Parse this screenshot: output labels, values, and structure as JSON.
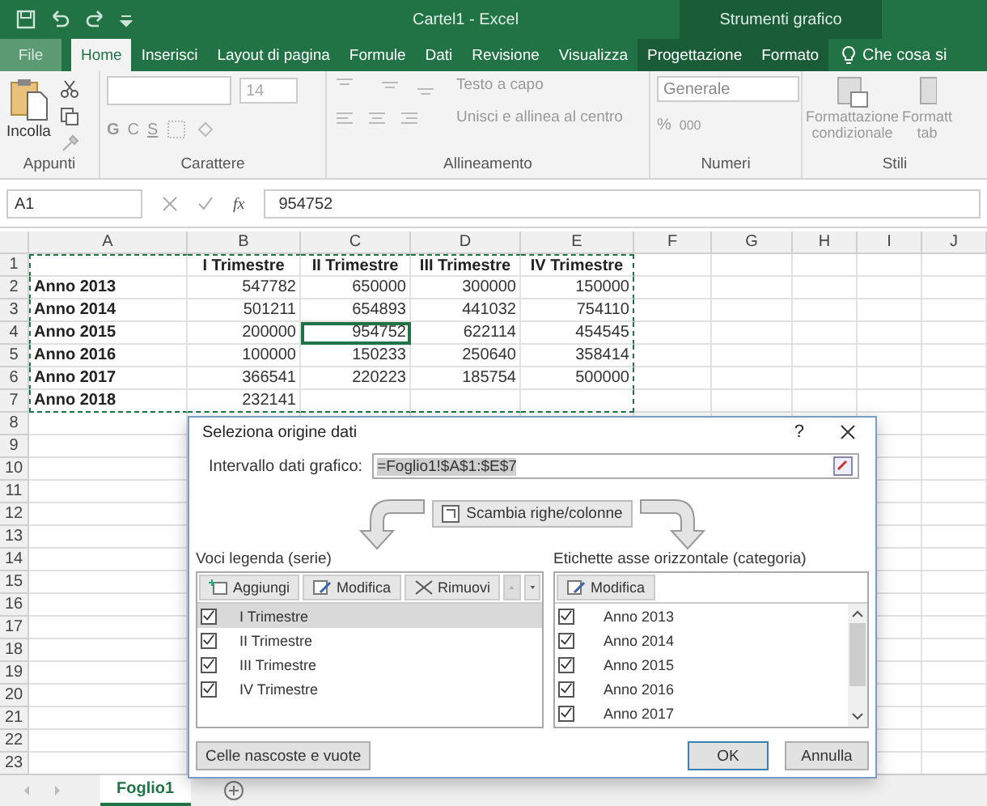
{
  "window": {
    "title": "Cartel1 - Excel",
    "context_title": "Strumenti grafico"
  },
  "tabs": [
    {
      "label": "File",
      "selected": false,
      "kind": "file"
    },
    {
      "label": "Home",
      "selected": true,
      "kind": "normal"
    },
    {
      "label": "Inserisci",
      "selected": false,
      "kind": "normal"
    },
    {
      "label": "Layout di pagina",
      "selected": false,
      "kind": "normal"
    },
    {
      "label": "Formule",
      "selected": false,
      "kind": "normal"
    },
    {
      "label": "Dati",
      "selected": false,
      "kind": "normal"
    },
    {
      "label": "Revisione",
      "selected": false,
      "kind": "normal"
    },
    {
      "label": "Visualizza",
      "selected": false,
      "kind": "normal"
    },
    {
      "label": "Progettazione",
      "selected": false,
      "kind": "contextual"
    },
    {
      "label": "Formato",
      "selected": false,
      "kind": "contextual"
    }
  ],
  "tell_me": "Che cosa si",
  "ribbon": {
    "clipboard": {
      "paste": "Incolla",
      "label": "Appunti"
    },
    "font": {
      "size": "14",
      "bold": "G",
      "italic": "C",
      "underline": "S",
      "label": "Carattere"
    },
    "alignment": {
      "wrap": "Testo a capo",
      "merge": "Unisci e allinea al centro",
      "label": "Allineamento"
    },
    "number": {
      "format": "Generale",
      "percent": "%",
      "thousands": "000",
      "label": "Numeri"
    },
    "styles": {
      "conditional": [
        "Formattazione",
        "condizionale"
      ],
      "table": [
        "Formatt",
        "tab"
      ],
      "label": "Stili"
    }
  },
  "formula_bar": {
    "name_box": "A1",
    "function_label": "fx",
    "value": "954752"
  },
  "sheet": {
    "columns": [
      "A",
      "B",
      "C",
      "D",
      "E",
      "F",
      "G",
      "H",
      "I",
      "J"
    ],
    "rows": [
      {
        "header": "1",
        "cells": [
          {
            "selected": false
          },
          {
            "text": "I Trimestre",
            "selected": false
          },
          {
            "text": "II Trimestre",
            "selected": false
          },
          {
            "text": "III Trimestre",
            "selected": false
          },
          {
            "text": "IV Trimestre",
            "selected": false
          }
        ]
      },
      {
        "header": "2",
        "cells": [
          {
            "text": "Anno 2013",
            "selected": false
          },
          {
            "text": "547782",
            "selected": false
          },
          {
            "text": "650000",
            "selected": false
          },
          {
            "text": "300000",
            "selected": false
          },
          {
            "text": "150000",
            "selected": false
          }
        ]
      },
      {
        "header": "3",
        "cells": [
          {
            "text": "Anno 2014",
            "selected": false
          },
          {
            "text": "501211",
            "selected": false
          },
          {
            "text": "654893",
            "selected": false
          },
          {
            "text": "441032",
            "selected": false
          },
          {
            "text": "754110",
            "selected": false
          }
        ]
      },
      {
        "header": "4",
        "cells": [
          {
            "text": "Anno 2015",
            "selected": false
          },
          {
            "text": "200000",
            "selected": false
          },
          {
            "text": "954752",
            "selected": true
          },
          {
            "text": "622114",
            "selected": false
          },
          {
            "text": "454545",
            "selected": false
          }
        ]
      },
      {
        "header": "5",
        "cells": [
          {
            "text": "Anno 2016",
            "selected": false
          },
          {
            "text": "100000",
            "selected": false
          },
          {
            "text": "150233",
            "selected": false
          },
          {
            "text": "250640",
            "selected": false
          },
          {
            "text": "358414",
            "selected": false
          }
        ]
      },
      {
        "header": "6",
        "cells": [
          {
            "text": "Anno 2017",
            "selected": false
          },
          {
            "text": "366541",
            "selected": false
          },
          {
            "text": "220223",
            "selected": false
          },
          {
            "text": "185754",
            "selected": false
          },
          {
            "text": "500000",
            "selected": false
          }
        ]
      },
      {
        "header": "7",
        "cells": [
          {
            "text": "Anno 2018",
            "selected": false
          },
          {
            "text": "232141",
            "selected": false
          },
          {
            "selected": false
          },
          {
            "selected": false
          },
          {
            "selected": false
          }
        ]
      },
      {
        "header": "8"
      },
      {
        "header": "9"
      },
      {
        "header": "10"
      },
      {
        "header": "11"
      },
      {
        "header": "12"
      },
      {
        "header": "13"
      },
      {
        "header": "14"
      },
      {
        "header": "15"
      },
      {
        "header": "16"
      },
      {
        "header": "17"
      },
      {
        "header": "18"
      },
      {
        "header": "19"
      },
      {
        "header": "20"
      },
      {
        "header": "21"
      },
      {
        "header": "22"
      },
      {
        "header": "23"
      }
    ]
  },
  "dialog": {
    "title": "Seleziona origine dati",
    "help": "?",
    "range_label": "Intervallo dati grafico:",
    "range_value": "=Foglio1!$A$1:$E$7",
    "swap_button": "Scambia righe/colonne",
    "legend": {
      "label": "Voci legenda (serie)",
      "buttons": [
        "Aggiungi",
        "Modifica",
        "Rimuovi"
      ],
      "items": [
        {
          "label": "I Trimestre",
          "checked": true,
          "selected": true
        },
        {
          "label": "II Trimestre",
          "checked": true,
          "selected": false
        },
        {
          "label": "III Trimestre",
          "checked": true,
          "selected": false
        },
        {
          "label": "IV Trimestre",
          "checked": true,
          "selected": false
        }
      ]
    },
    "axis": {
      "label": "Etichette asse orizzontale (categoria)",
      "button": "Modifica",
      "items": [
        {
          "label": "Anno 2013",
          "checked": true
        },
        {
          "label": "Anno 2014",
          "checked": true
        },
        {
          "label": "Anno 2015",
          "checked": true
        },
        {
          "label": "Anno 2016",
          "checked": true
        },
        {
          "label": "Anno 2017",
          "checked": true
        }
      ]
    },
    "hidden_cells_button": "Celle nascoste e vuote",
    "ok": "OK",
    "cancel": "Annulla"
  },
  "sheet_tabs": [
    {
      "label": "Foglio1",
      "selected": true
    }
  ]
}
